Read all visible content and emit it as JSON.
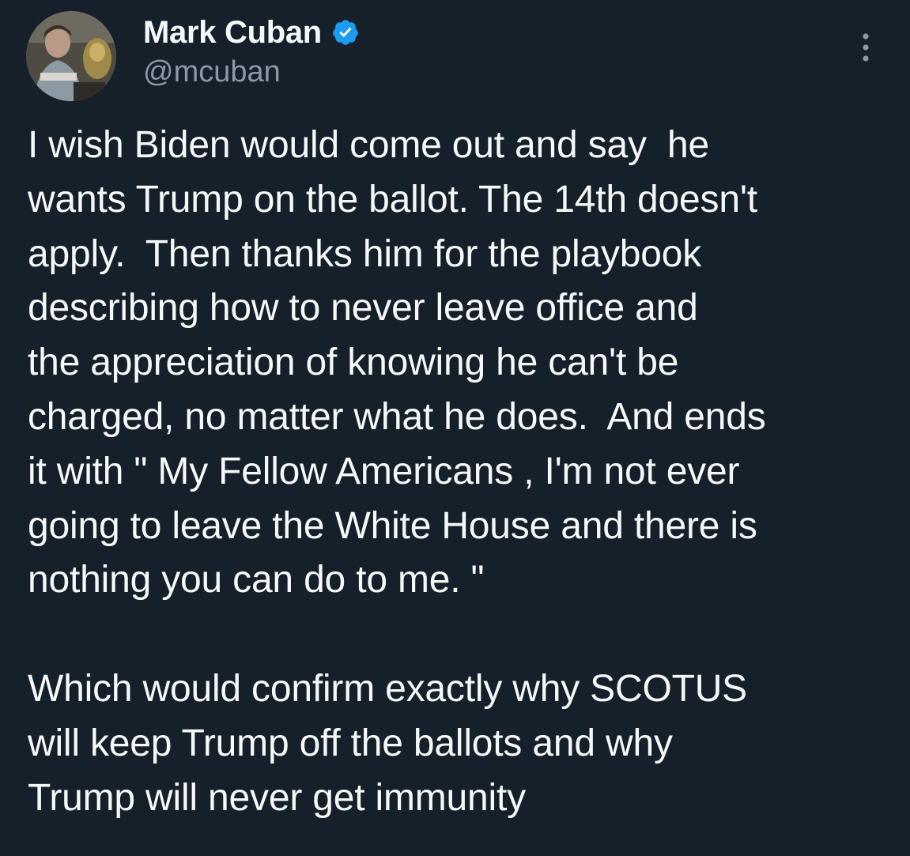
{
  "author": {
    "name": "Mark Cuban",
    "handle": "@mcuban",
    "avatar_icon": "profile-photo",
    "verified_icon": "verified-badge-icon",
    "verified_color": "#1d9bf0"
  },
  "menu_icon": "more-options-icon",
  "tweet": {
    "text": "I wish Biden would come out and say  he\nwants Trump on the ballot. The 14th doesn't\napply.  Then thanks him for the playbook\ndescribing how to never leave office and\nthe appreciation of knowing he can't be\ncharged, no matter what he does.  And ends\nit with \" My Fellow Americans , I'm not ever\ngoing to leave the White House and there is\nnothing you can do to me. \"\n\nWhich would confirm exactly why SCOTUS\nwill keep Trump off the ballots and why\nTrump will never get immunity"
  },
  "colors": {
    "background": "#15202b",
    "text": "#f7f9f9",
    "secondary_text": "#8b98a5"
  }
}
